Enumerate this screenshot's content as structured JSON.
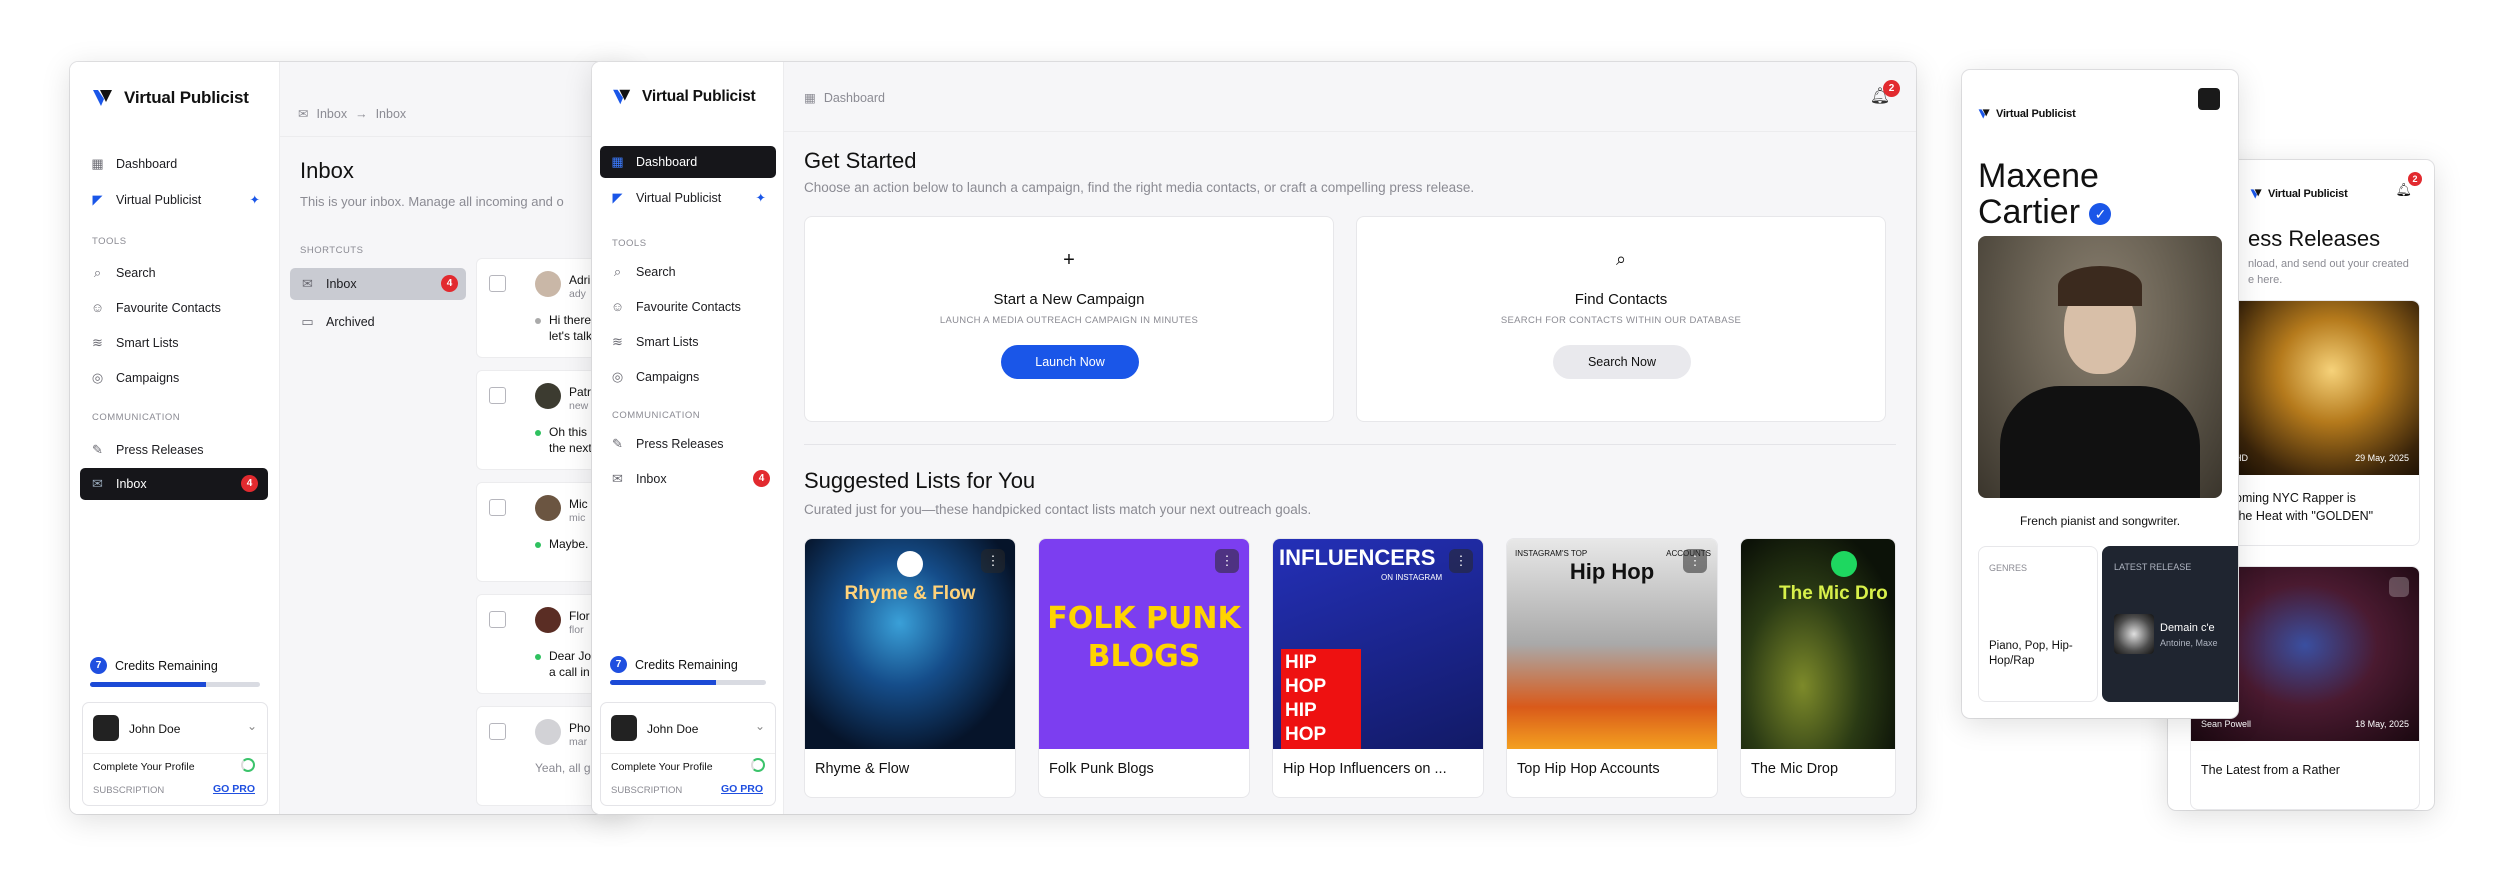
{
  "brand": {
    "name": "Virtual Publicist"
  },
  "sidebar": {
    "dashboard": "Dashboard",
    "workspace": "Virtual Publicist",
    "tools_label": "TOOLS",
    "search": "Search",
    "favourites": "Favourite Contacts",
    "smart_lists": "Smart Lists",
    "campaigns": "Campaigns",
    "communication_label": "COMMUNICATION",
    "press_releases": "Press Releases",
    "inbox": "Inbox",
    "inbox_count": "4",
    "credits_count": "7",
    "credits_label": "Credits Remaining",
    "credits_fraction": 0.68,
    "user_name": "John Doe",
    "complete_profile": "Complete Your Profile",
    "subscription": "SUBSCRIPTION",
    "go_pro": "GO PRO"
  },
  "inbox_window": {
    "crumb_a": "Inbox",
    "crumb_arrow": "→",
    "crumb_b": "Inbox",
    "title": "Inbox",
    "subtitle": "This is your inbox. Manage all incoming and o",
    "shortcuts_label": "SHORTCUTS",
    "shortcut_inbox": "Inbox",
    "shortcut_inbox_count": "4",
    "shortcut_archived": "Archived",
    "messages": [
      {
        "name": "Adri",
        "sub": "ady",
        "preview1": "Hi there,",
        "preview2": "let's talk a",
        "status": "gray"
      },
      {
        "name": "Patr",
        "sub": "new",
        "preview1": "Oh this is",
        "preview2": "the next t",
        "status": "green"
      },
      {
        "name": "Mic",
        "sub": "mic",
        "preview1": "Maybe.",
        "preview2": "",
        "status": "green"
      },
      {
        "name": "Flor",
        "sub": "flor",
        "preview1": "Dear John",
        "preview2": "a call in t",
        "status": "green"
      },
      {
        "name": "Pho",
        "sub": "mar",
        "preview1": "Yeah, all g",
        "preview2": "",
        "status": "none"
      }
    ]
  },
  "dashboard": {
    "crumb": "Dashboard",
    "notif_count": "2",
    "get_started_title": "Get Started",
    "get_started_sub": "Choose an action below to launch a campaign, find the right media contacts, or craft a compelling press release.",
    "card1": {
      "icon": "+",
      "title": "Start a New Campaign",
      "sub": "LAUNCH A MEDIA OUTREACH CAMPAIGN IN MINUTES",
      "button": "Launch Now"
    },
    "card2": {
      "title": "Find Contacts",
      "sub": "SEARCH FOR CONTACTS WITHIN OUR DATABASE",
      "button": "Search Now"
    },
    "suggested_title": "Suggested Lists for You",
    "suggested_sub": "Curated just for you—these handpicked contact lists match your next outreach goals.",
    "lists": [
      {
        "title": "Rhyme & Flow",
        "art": "Rhyme & Flow",
        "art2": ""
      },
      {
        "title": "Folk Punk Blogs",
        "art": "FOLK PUNK",
        "art2": "BLOGS"
      },
      {
        "title": "Hip Hop Influencers on ...",
        "art": "INFLUENCERS",
        "art2": "ON INSTAGRAM"
      },
      {
        "title": "Top Hip Hop Accounts",
        "art": "Hip Hop",
        "art2": "INSTAGRAM'S TOP"
      },
      {
        "title": "The Mic Drop",
        "art": "The Mic Dro",
        "art2": ""
      }
    ],
    "lists_art3": [
      "",
      "",
      "HIP HOP HIP HOP",
      "ACCOUNTS",
      ""
    ]
  },
  "profile": {
    "name_line1": "Maxene",
    "name_line2": "Cartier",
    "bio": "French pianist and songwriter.",
    "genres_label": "GENRES",
    "genres": "Piano, Pop, Hip-Hop/Rap",
    "latest_label": "LATEST RELEASE",
    "latest_title": "Demain c'e",
    "latest_artist": "Antoine, Maxe"
  },
  "press_window": {
    "notif_count": "2",
    "title": "ess Releases",
    "sub1": "nload, and send out your created",
    "sub2": "e here.",
    "card1_tag": "HD",
    "card1_date": "29 May, 2025",
    "card1_title1": "oming NYC Rapper is",
    "card1_title2": "the Heat with \"GOLDEN\"",
    "card2_author": "Sean Powell",
    "card2_date": "18 May, 2025",
    "card2_title": "The Latest from a Rather"
  },
  "colors": {
    "accent": "#1a56e8",
    "badge": "#e22a2f",
    "dark": "#16161a"
  }
}
